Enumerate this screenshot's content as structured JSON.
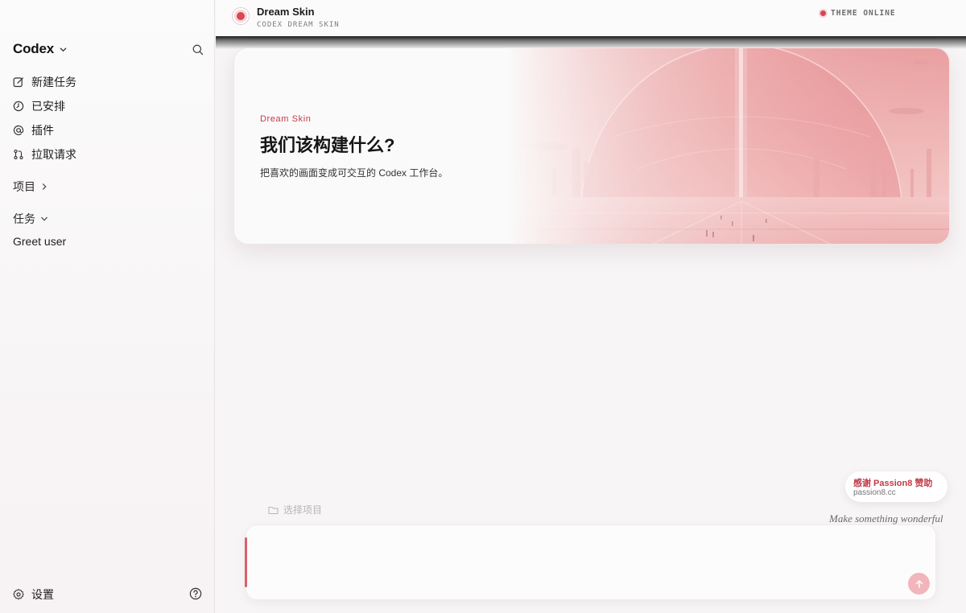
{
  "sidebar": {
    "brand": "Codex",
    "nav": [
      {
        "label": "新建任务",
        "icon": "edit-icon"
      },
      {
        "label": "已安排",
        "icon": "clock-icon"
      },
      {
        "label": "插件",
        "icon": "at-icon"
      },
      {
        "label": "拉取请求",
        "icon": "pull-request-icon"
      }
    ],
    "projects_label": "项目",
    "tasks_label": "任务",
    "tasks": [
      "Greet user"
    ],
    "settings_label": "设置"
  },
  "header": {
    "title": "Dream Skin",
    "subtitle": "CODEX DREAM SKIN",
    "status": "THEME ONLINE"
  },
  "hero": {
    "eyebrow": "Dream Skin",
    "title": "我们该构建什么?",
    "description": "把喜欢的画面变成可交互的 Codex 工作台。"
  },
  "sponsor": {
    "title": "感谢 Passion8 赞助",
    "url": "passion8.cc"
  },
  "tagline": "Make something wonderful",
  "composer": {
    "project_picker": "选择项目",
    "placeholder": ""
  },
  "colors": {
    "accent": "#d64853",
    "status_dot": "#d84552",
    "send_button": "#f2b5bb"
  }
}
